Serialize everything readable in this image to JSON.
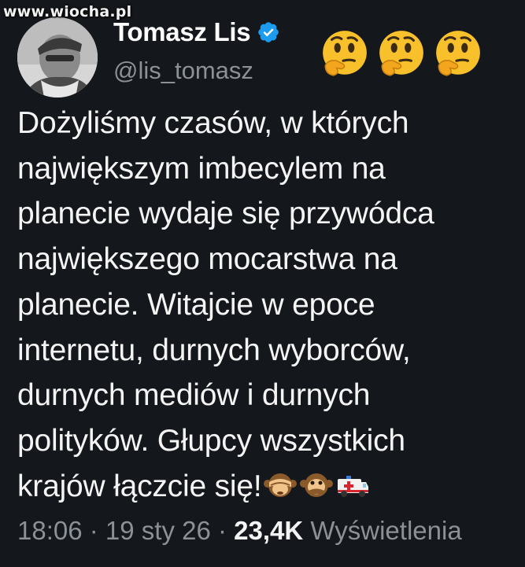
{
  "watermark": "www.wiocha.pl",
  "author": {
    "display_name": "Tomasz Lis",
    "handle": "@lis_tomasz",
    "verified_icon": "verified-badge-icon"
  },
  "header_emojis": [
    "thinking-face",
    "thinking-face",
    "thinking-face"
  ],
  "tweet": {
    "lines": [
      "Dożyliśmy czasów, w których",
      "największym imbecylem na",
      "planecie wydaje się przywódca",
      "największego mocarstwa na",
      "planecie. Witajcie w epoce",
      "internetu, durnych wyborców,",
      "durnych mediów i durnych",
      "polityków. Głupcy wszystkich",
      "krajów łączcie się!"
    ],
    "trailing_emojis": [
      "see-no-evil-monkey",
      "speak-no-evil-monkey",
      "ambulance"
    ]
  },
  "meta": {
    "time": "18:06",
    "sep1": " · ",
    "date": "19 sty 26",
    "sep2": " · ",
    "views_count": "23,4K",
    "views_label": " Wyświetlenia"
  },
  "colors": {
    "background": "#14171b",
    "text": "#f4f4f4",
    "muted": "#8b9197",
    "verified": "#1d9bf0"
  }
}
